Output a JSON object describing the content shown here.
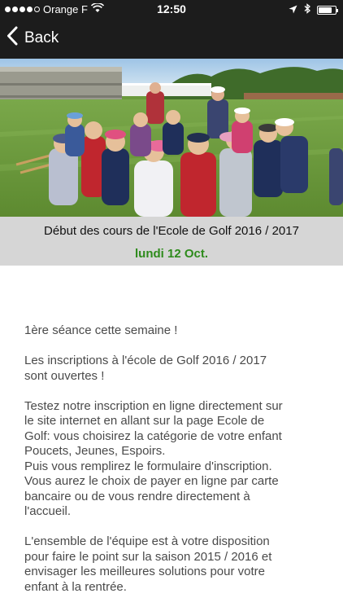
{
  "status_bar": {
    "carrier": "Orange F",
    "time": "12:50",
    "icons": [
      "signal-dots-icon",
      "wifi-icon",
      "location-arrow-icon",
      "bluetooth-icon",
      "battery-icon"
    ]
  },
  "nav": {
    "back_label": "Back",
    "back_icon": "chevron-left-icon"
  },
  "photo": {
    "description": "children-golf-lesson-photo"
  },
  "header": {
    "title": "Début des cours de l'Ecole de Golf 2016 / 2017",
    "date": "lundi 12 Oct.",
    "date_color": "#2e8b1c"
  },
  "article": {
    "p1": "1ère séance cette semaine !",
    "p2": "Les inscriptions à l'école de Golf 2016 / 2017 sont ouvertes !",
    "p3": "Testez notre inscription en ligne directement sur le site internet en allant sur la page Ecole de Golf: vous choisirez la catégorie de votre enfant Poucets, Jeunes, Espoirs.",
    "p3b": "Puis vous remplirez le formulaire d'inscription.",
    "p3c": "Vous aurez le choix de payer en ligne par carte bancaire ou de vous rendre directement à l'accueil.",
    "p4": "L'ensemble de l'équipe est à votre disposition pour faire le point sur la saison 2015 / 2016 et envisager les meilleures solutions pour votre enfant à la rentrée."
  }
}
